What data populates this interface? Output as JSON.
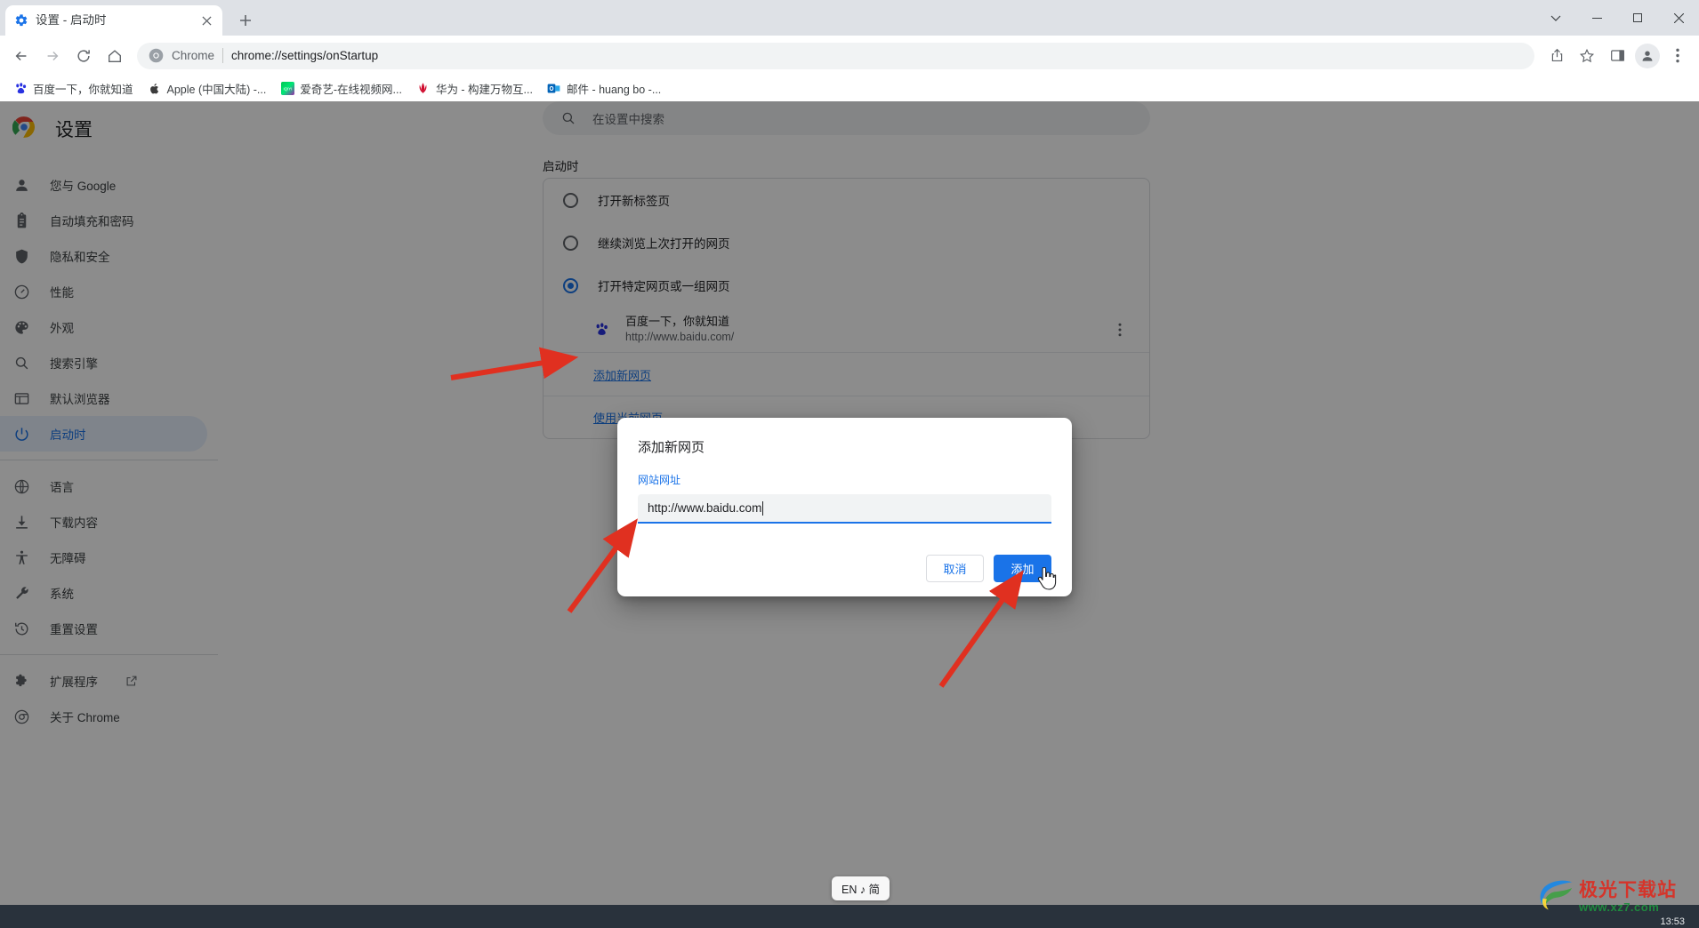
{
  "window": {
    "tab": {
      "title": "设置 - 启动时",
      "favicon": "gear-icon",
      "close": "×"
    },
    "new_tab_label": "+",
    "controls": {
      "minimize_all": "⌄",
      "minimize": "—",
      "maximize": "▢",
      "close": "✕"
    }
  },
  "toolbar": {
    "back": "←",
    "forward": "→",
    "reload": "⟳",
    "home": "⌂",
    "omnibox": {
      "site_label": "Chrome",
      "url": "chrome://settings/onStartup"
    },
    "share": "share-icon",
    "bookmark": "star-icon",
    "side_panel": "side-panel-icon",
    "profile": "profile-icon",
    "menu": "⋮"
  },
  "bookmarks": [
    {
      "label": "百度一下，你就知道",
      "icon": "baidu-icon"
    },
    {
      "label": "Apple (中国大陆) -...",
      "icon": "apple-icon"
    },
    {
      "label": "爱奇艺-在线视频网...",
      "icon": "iqiyi-icon"
    },
    {
      "label": "华为 - 构建万物互...",
      "icon": "huawei-icon"
    },
    {
      "label": "邮件 - huang bo -...",
      "icon": "outlook-icon"
    }
  ],
  "sidebar": {
    "brand": "设置",
    "items": [
      {
        "label": "您与 Google",
        "icon": "person-icon",
        "selected": false
      },
      {
        "label": "自动填充和密码",
        "icon": "clipboard-icon",
        "selected": false
      },
      {
        "label": "隐私和安全",
        "icon": "shield-icon",
        "selected": false
      },
      {
        "label": "性能",
        "icon": "speedometer-icon",
        "selected": false
      },
      {
        "label": "外观",
        "icon": "palette-icon",
        "selected": false
      },
      {
        "label": "搜索引擎",
        "icon": "search-icon",
        "selected": false
      },
      {
        "label": "默认浏览器",
        "icon": "browser-window-icon",
        "selected": false
      },
      {
        "label": "启动时",
        "icon": "power-icon",
        "selected": true
      }
    ],
    "items2": [
      {
        "label": "语言",
        "icon": "globe-icon"
      },
      {
        "label": "下载内容",
        "icon": "download-icon"
      },
      {
        "label": "无障碍",
        "icon": "accessibility-icon"
      },
      {
        "label": "系统",
        "icon": "wrench-icon"
      },
      {
        "label": "重置设置",
        "icon": "history-restore-icon"
      }
    ],
    "items3": [
      {
        "label": "扩展程序",
        "icon": "puzzle-icon",
        "external": true
      },
      {
        "label": "关于 Chrome",
        "icon": "chrome-icon",
        "external": false
      }
    ]
  },
  "main": {
    "search_placeholder": "在设置中搜索",
    "section_title": "启动时",
    "options": [
      {
        "label": "打开新标签页",
        "checked": false
      },
      {
        "label": "继续浏览上次打开的网页",
        "checked": false
      },
      {
        "label": "打开特定网页或一组网页",
        "checked": true
      }
    ],
    "startup_sites": [
      {
        "name": "百度一下，你就知道",
        "url": "http://www.baidu.com/",
        "favicon": "baidu-icon",
        "more": "⋮"
      }
    ],
    "links": [
      {
        "label": "添加新网页"
      },
      {
        "label": "使用当前网页"
      }
    ]
  },
  "dialog": {
    "title": "添加新网页",
    "field_label": "网站网址",
    "input_value": "http://www.baidu.com",
    "cancel_label": "取消",
    "add_label": "添加"
  },
  "taskbar": {
    "ime": "EN ♪ 简",
    "clock": "13:53"
  },
  "watermark": {
    "main": "极光下载站",
    "sub": "www.xz7.com"
  },
  "colors": {
    "accent": "#1a73e8",
    "selected_bg": "#e8f0fe",
    "annotation": "#e03020",
    "taskbar": "#29323c"
  }
}
